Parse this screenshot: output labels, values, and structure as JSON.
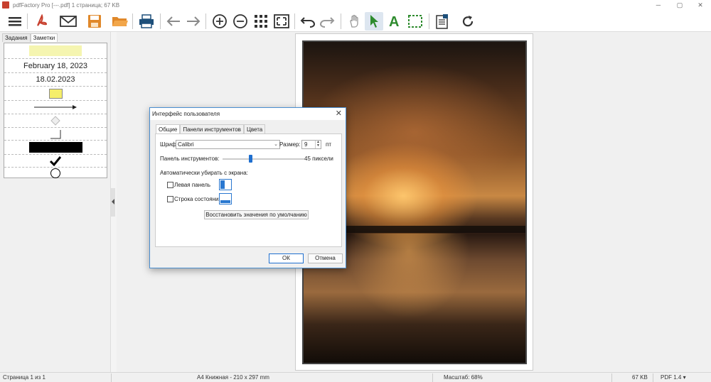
{
  "window": {
    "title": "pdfFactory Pro [---.pdf] 1 страница; 67 KB"
  },
  "toolbar": {
    "items": [
      "menu-icon",
      "pdf-icon",
      "email-icon",
      "save-icon",
      "open-folder-icon",
      "print-icon",
      "back-arrow-icon",
      "forward-arrow-icon",
      "zoom-in-icon",
      "zoom-out-icon",
      "grid-icon",
      "fit-page-icon",
      "undo-icon",
      "redo-icon",
      "hand-tool-icon",
      "select-arrow-icon",
      "text-tool-icon",
      "crop-tool-icon",
      "notes-icon",
      "refresh-icon"
    ],
    "active": "select-arrow-icon"
  },
  "leftpanel": {
    "tabs": [
      "Задания",
      "Заметки"
    ],
    "selected_tab": "Заметки",
    "notes": {
      "date_long": "February 18, 2023",
      "date_short": "18.02.2023"
    }
  },
  "dialog": {
    "title": "Интерфейс пользователя",
    "tabs": [
      "Общие",
      "Панели инструментов",
      "Цвета"
    ],
    "selected_tab": "Общие",
    "font_label": "Шрифт:",
    "font_value": "Calibri",
    "size_label": "Размер:",
    "size_value": "9",
    "size_unit": "пт",
    "toolbar_label": "Панель инструментов:",
    "toolbar_value": "45 пиксели",
    "toolbar_slider_fraction": 0.34,
    "auto_hide_label": "Автоматически убирать с экрана:",
    "left_panel_label": "Левая панель",
    "left_panel_checked": false,
    "status_bar_label": "Строка состояния",
    "status_bar_checked": false,
    "restore_button": "Восстановить значения по умолчанию",
    "ok_button": "ОК",
    "cancel_button": "Отмена"
  },
  "statusbar": {
    "page": "Страница 1 из 1",
    "paper": "A4 Книжная - 210 x 297 mm",
    "zoom": "Масштаб: 68%",
    "size": "67 KB",
    "pdf_version": "PDF 1.4 ▾"
  },
  "colors": {
    "accent": "#1f6fcf",
    "pdf_red": "#c7402e",
    "save_orange": "#e0882a",
    "select_green": "#2e8b2e"
  }
}
